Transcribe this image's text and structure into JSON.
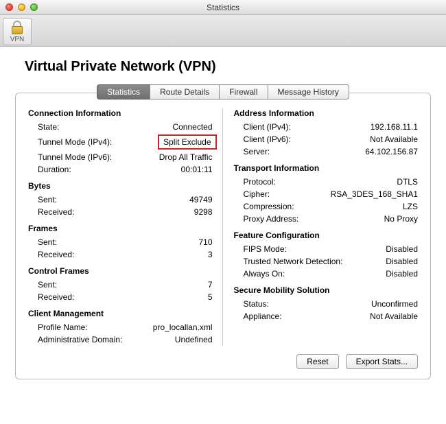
{
  "window": {
    "title": "Statistics"
  },
  "toolbar": {
    "vpn_label": "VPN"
  },
  "page": {
    "heading": "Virtual Private Network (VPN)"
  },
  "tabs": {
    "statistics": "Statistics",
    "route_details": "Route Details",
    "firewall": "Firewall",
    "message_history": "Message History"
  },
  "left": {
    "connection_information": {
      "heading": "Connection Information",
      "state_label": "State:",
      "state_value": "Connected",
      "tunnel_v4_label": "Tunnel Mode (IPv4):",
      "tunnel_v4_value": "Split Exclude",
      "tunnel_v6_label": "Tunnel Mode (IPv6):",
      "tunnel_v6_value": "Drop All Traffic",
      "duration_label": "Duration:",
      "duration_value": "00:01:11"
    },
    "bytes": {
      "heading": "Bytes",
      "sent_label": "Sent:",
      "sent_value": "49749",
      "received_label": "Received:",
      "received_value": "9298"
    },
    "frames": {
      "heading": "Frames",
      "sent_label": "Sent:",
      "sent_value": "710",
      "received_label": "Received:",
      "received_value": "3"
    },
    "control_frames": {
      "heading": "Control Frames",
      "sent_label": "Sent:",
      "sent_value": "7",
      "received_label": "Received:",
      "received_value": "5"
    },
    "client_management": {
      "heading": "Client Management",
      "profile_label": "Profile Name:",
      "profile_value": "pro_locallan.xml",
      "admin_label": "Administrative Domain:",
      "admin_value": "Undefined"
    }
  },
  "right": {
    "address_information": {
      "heading": "Address Information",
      "client_v4_label": "Client (IPv4):",
      "client_v4_value": "192.168.11.1",
      "client_v6_label": "Client (IPv6):",
      "client_v6_value": "Not Available",
      "server_label": "Server:",
      "server_value": "64.102.156.87"
    },
    "transport_information": {
      "heading": "Transport Information",
      "protocol_label": "Protocol:",
      "protocol_value": "DTLS",
      "cipher_label": "Cipher:",
      "cipher_value": "RSA_3DES_168_SHA1",
      "compression_label": "Compression:",
      "compression_value": "LZS",
      "proxy_label": "Proxy Address:",
      "proxy_value": "No Proxy"
    },
    "feature_configuration": {
      "heading": "Feature Configuration",
      "fips_label": "FIPS Mode:",
      "fips_value": "Disabled",
      "tnd_label": "Trusted Network Detection:",
      "tnd_value": "Disabled",
      "always_on_label": "Always On:",
      "always_on_value": "Disabled"
    },
    "secure_mobility": {
      "heading": "Secure Mobility Solution",
      "status_label": "Status:",
      "status_value": "Unconfirmed",
      "appliance_label": "Appliance:",
      "appliance_value": "Not Available"
    }
  },
  "buttons": {
    "reset": "Reset",
    "export": "Export Stats..."
  }
}
